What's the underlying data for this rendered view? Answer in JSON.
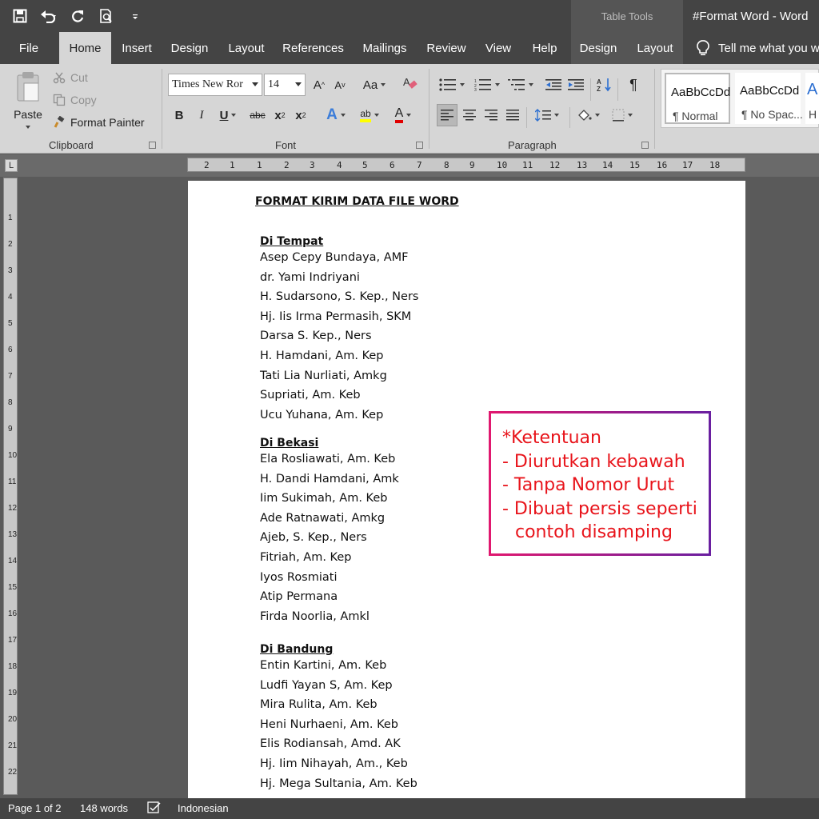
{
  "titlebar": {
    "context_label": "Table Tools",
    "title": "#Format Word  -  Word"
  },
  "tabs": [
    {
      "label": "File"
    },
    {
      "label": "Home"
    },
    {
      "label": "Insert"
    },
    {
      "label": "Design"
    },
    {
      "label": "Layout"
    },
    {
      "label": "References"
    },
    {
      "label": "Mailings"
    },
    {
      "label": "Review"
    },
    {
      "label": "View"
    },
    {
      "label": "Help"
    },
    {
      "label": "Design"
    },
    {
      "label": "Layout"
    }
  ],
  "tell_me": "Tell me what you w",
  "ribbon": {
    "clipboard": {
      "paste": "Paste",
      "cut": "Cut",
      "copy": "Copy",
      "format_painter": "Format Painter",
      "label": "Clipboard"
    },
    "font": {
      "name": "Times New Ror",
      "size": "14",
      "grow": "A",
      "shrink": "A",
      "case": "Aa",
      "bold": "B",
      "italic": "I",
      "underline": "U",
      "strike": "abc",
      "subscript": "x",
      "superscript": "x",
      "effects": "A",
      "highlight": "ab",
      "color": "A",
      "label": "Font",
      "highlight_color": "#ffff00",
      "font_color": "#e00000"
    },
    "paragraph": {
      "pilcrow": "¶",
      "label": "Paragraph"
    },
    "styles": [
      {
        "sample": "AaBbCcDd",
        "name": "¶ Normal"
      },
      {
        "sample": "AaBbCcDd",
        "name": "¶ No Spac..."
      },
      {
        "sample": "A",
        "name": "H"
      }
    ]
  },
  "ruler": {
    "labels": [
      "2",
      "1",
      "1",
      "2",
      "3",
      "4",
      "5",
      "6",
      "7",
      "8",
      "9",
      "10",
      "11",
      "12",
      "13",
      "14",
      "15",
      "16",
      "17",
      "18"
    ]
  },
  "vruler": {
    "labels": [
      "1",
      "2",
      "3",
      "4",
      "5",
      "6",
      "7",
      "8",
      "9",
      "10",
      "11",
      "12",
      "13",
      "14",
      "15",
      "16",
      "17",
      "18",
      "19",
      "20",
      "21",
      "22"
    ]
  },
  "document": {
    "title": "FORMAT KIRIM DATA FILE WORD",
    "sections": [
      {
        "heading": "Di Tempat",
        "names": [
          "Asep Cepy Bundaya, AMF",
          "dr. Yami Indriyani",
          "H. Sudarsono, S. Kep., Ners",
          "Hj. Iis Irma Permasih, SKM",
          "Darsa S. Kep., Ners",
          "H. Hamdani, Am. Kep",
          "Tati Lia Nurliati, Amkg",
          "Supriati, Am. Keb",
          "Ucu Yuhana, Am. Kep"
        ]
      },
      {
        "heading": "Di Bekasi",
        "names": [
          "Ela Rosliawati, Am. Keb",
          "H. Dandi Hamdani, Amk",
          "Iim Sukimah, Am. Keb",
          "Ade Ratnawati, Amkg",
          "Ajeb, S. Kep., Ners",
          "Fitriah, Am. Kep",
          "Iyos Rosmiati",
          "Atip Permana",
          "Firda Noorlia, Amkl"
        ]
      },
      {
        "heading": "Di Bandung",
        "names": [
          "Entin Kartini, Am. Keb",
          "Ludfi Yayan S, Am. Kep",
          "Mira Rulita, Am. Keb",
          "Heni Nurhaeni, Am. Keb",
          "Elis Rodiansah, Amd. AK",
          "Hj. Iim Nihayah, Am., Keb",
          "Hj. Mega Sultania, Am. Keb"
        ]
      }
    ],
    "note": [
      "*Ketentuan",
      "- Diurutkan kebawah",
      "- Tanpa Nomor Urut",
      "- Dibuat persis seperti",
      "contoh disamping"
    ],
    "note_color": "#e8141b"
  },
  "statusbar": {
    "page": "Page 1 of 2",
    "words": "148 words",
    "language": "Indonesian"
  }
}
